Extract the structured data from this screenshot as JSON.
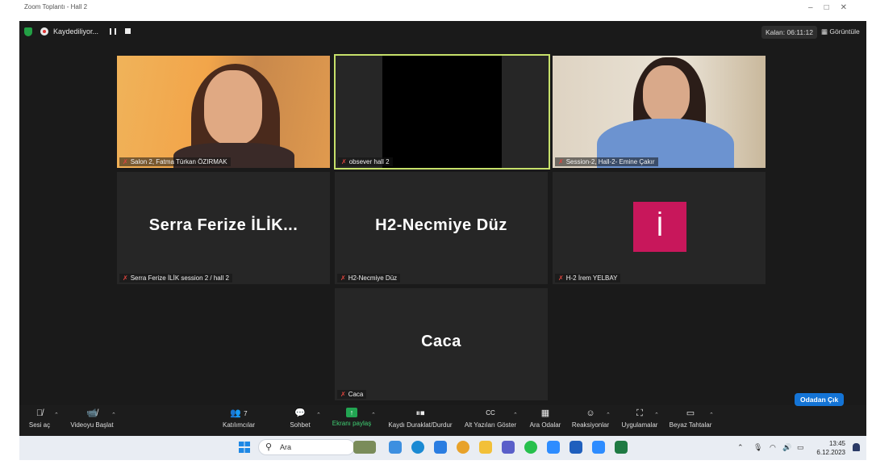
{
  "titlebar": {
    "title": "Zoom Toplantı - Hall 2"
  },
  "recording": {
    "label": "Kaydediliyor..."
  },
  "remaining_time": "Kalan: 06:11:12",
  "view_label": "Görüntüle",
  "tiles": [
    {
      "name": "Salon 2, Fatma Türkan ÖZIRMAK"
    },
    {
      "name": "obsever hall 2"
    },
    {
      "name": "Session-2, Hall-2- Emine Çakır"
    },
    {
      "name": "Serra Ferize İLİK session 2 / hall 2",
      "display": "Serra Ferize İLİK..."
    },
    {
      "name": "H2-Necmiye Düz",
      "display": "H2-Necmiye Düz"
    },
    {
      "name": "H-2 İrem YELBAY",
      "avatar": "İ"
    },
    {
      "name": "Caca",
      "display": "Caca"
    }
  ],
  "toolbar": {
    "unmute": "Sesi aç",
    "start_video": "Videoyu Başlat",
    "participants": "Katılımcılar",
    "participant_count": "7",
    "chat": "Sohbet",
    "share_screen": "Ekranı paylaş",
    "pause_stop_recording": "Kaydı Duraklat/Durdur",
    "captions": "Alt Yazıları Göster",
    "breakout_rooms": "Ara Odalar",
    "reactions": "Reaksiyonlar",
    "apps": "Uygulamalar",
    "whiteboards": "Beyaz Tahtalar",
    "leave_room": "Odadan Çık"
  },
  "taskbar": {
    "search_placeholder": "Ara",
    "time": "13:45",
    "date": "6.12.2023"
  },
  "colors": {
    "active_speaker_border": "#c6e06a",
    "share_green": "#22a552",
    "leave_blue": "#1474d6",
    "avatar_pink": "#c8175b",
    "muted_red": "#e0443e"
  }
}
